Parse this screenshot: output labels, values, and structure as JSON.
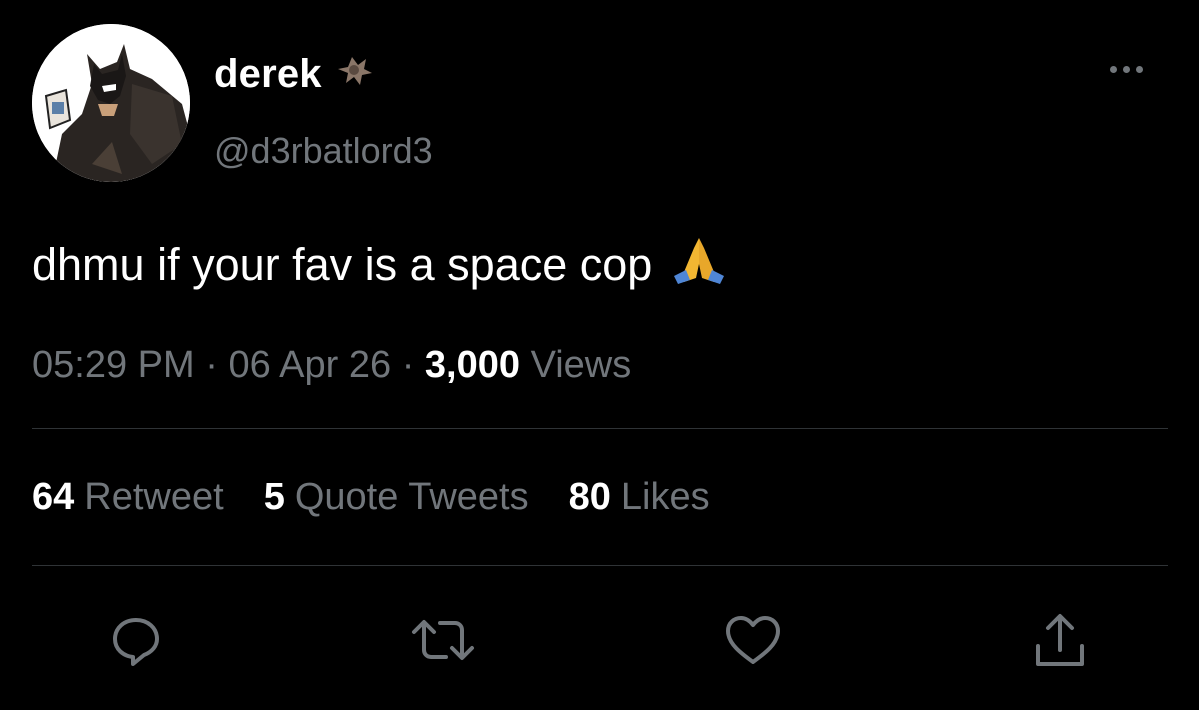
{
  "author": {
    "display_name": "derek",
    "name_icon": "bat-emoji",
    "handle": "@d3rbatlord3",
    "avatar_icon": "batman-avatar"
  },
  "tweet": {
    "text": "dhmu if your fav is a space cop",
    "emoji": "folded-hands-emoji"
  },
  "meta": {
    "time": "05:29 PM",
    "sep1": "·",
    "date": "06 Apr 26",
    "sep2": "·",
    "views_count": "3,000",
    "views_label": "Views"
  },
  "stats": {
    "retweets_count": "64",
    "retweets_label": "Retweet",
    "quotes_count": "5",
    "quotes_label": "Quote Tweets",
    "likes_count": "80",
    "likes_label": "Likes"
  },
  "actions": [
    {
      "icon": "reply-icon"
    },
    {
      "icon": "retweet-icon"
    },
    {
      "icon": "like-icon"
    },
    {
      "icon": "share-icon"
    }
  ],
  "colors": {
    "background": "#000000",
    "primary_text": "#ffffff",
    "secondary_text": "#71767b",
    "divider": "#2f3336"
  }
}
